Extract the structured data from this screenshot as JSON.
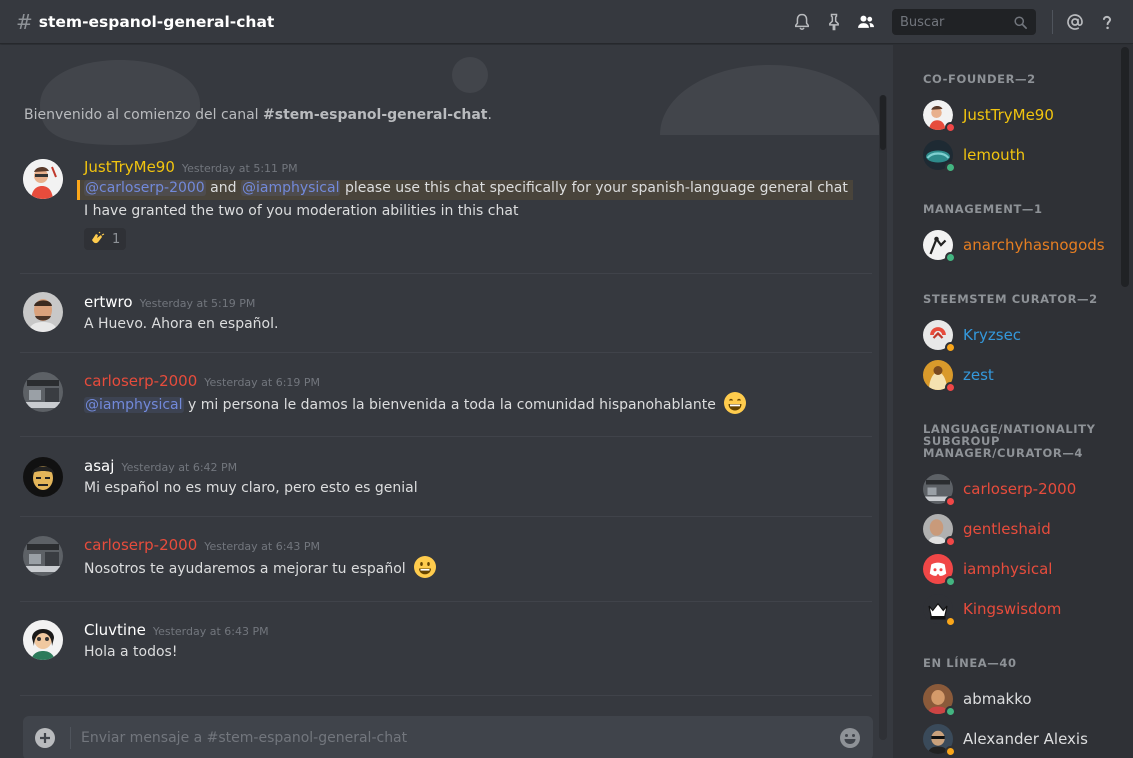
{
  "colors": {
    "gold": "#f1c40f",
    "orange": "#e67e22",
    "blue": "#3498db",
    "red": "#e74c3c",
    "white": "#ffffff",
    "grey": "#dcddde",
    "online": "#43b581",
    "idle": "#faa61a",
    "dnd": "#f04747",
    "mention": "#7289da"
  },
  "header": {
    "hash": "#",
    "channel": "stem-espanol-general-chat",
    "search_placeholder": "Buscar",
    "icons": [
      "bell-icon",
      "pin-icon",
      "members-icon",
      "search-icon",
      "at-icon",
      "help-icon"
    ]
  },
  "welcome": {
    "prefix": "Bienvenido al comienzo del canal ",
    "channel": "#stem-espanol-general-chat",
    "suffix": "."
  },
  "messages": [
    {
      "author": "JustTryMe90",
      "timestamp": "Yesterday at 5:11 PM",
      "line1": {
        "mention1": "@carloserp-2000",
        "and": "and",
        "mention2": "@iamphysical",
        "text": "please use this chat specifically for your spanish-language general chat"
      },
      "line2": "I have granted the two of you moderation abilities in this chat",
      "reaction": {
        "emoji": "clap",
        "count": "1"
      }
    },
    {
      "author": "ertwro",
      "timestamp": "Yesterday at 5:19 PM",
      "text": "A Huevo. Ahora en español."
    },
    {
      "author": "carloserp-2000",
      "timestamp": "Yesterday at 6:19 PM",
      "mention": "@iamphysical",
      "text": " y mi persona le damos la bienvenida a toda la comunidad hispanohablante",
      "emoji": "grinning-smile"
    },
    {
      "author": "asaj",
      "timestamp": "Yesterday at 6:42 PM",
      "text": "Mi español no es muy claro, pero esto es genial"
    },
    {
      "author": "carloserp-2000",
      "timestamp": "Yesterday at 6:43 PM",
      "text": "Nosotros te ayudaremos a mejorar tu español",
      "emoji": "smiley"
    },
    {
      "author": "Cluvtine",
      "timestamp": "Yesterday at 6:43 PM",
      "text": "Hola a todos!"
    }
  ],
  "input": {
    "placeholder": "Enviar mensaje a #stem-espanol-general-chat"
  },
  "members": {
    "groups": [
      {
        "role": "CO-FOUNDER—2",
        "members": [
          {
            "name": "JustTryMe90",
            "color": "gold",
            "status": "dnd"
          },
          {
            "name": "lemouth",
            "color": "gold",
            "status": "online"
          }
        ]
      },
      {
        "role": "MANAGEMENT—1",
        "members": [
          {
            "name": "anarchyhasnogods",
            "color": "orange",
            "status": "online"
          }
        ]
      },
      {
        "role": "STEEMSTEM CURATOR—2",
        "members": [
          {
            "name": "Kryzsec",
            "color": "blue",
            "status": "idle"
          },
          {
            "name": "zest",
            "color": "blue",
            "status": "dnd"
          }
        ]
      },
      {
        "role": "LANGUAGE/NATIONALITY SUBGROUP MANAGER/CURATOR—4",
        "members": [
          {
            "name": "carloserp-2000",
            "color": "red",
            "status": "dnd"
          },
          {
            "name": "gentleshaid",
            "color": "red",
            "status": "dnd"
          },
          {
            "name": "iamphysical",
            "color": "red",
            "status": "online"
          },
          {
            "name": "Kingswisdom",
            "color": "red",
            "status": "idle"
          }
        ]
      },
      {
        "role": "EN LÍNEA—40",
        "members": [
          {
            "name": "abmakko",
            "color": "grey",
            "status": "online"
          },
          {
            "name": "Alexander Alexis",
            "color": "grey",
            "status": "idle"
          }
        ]
      }
    ]
  }
}
